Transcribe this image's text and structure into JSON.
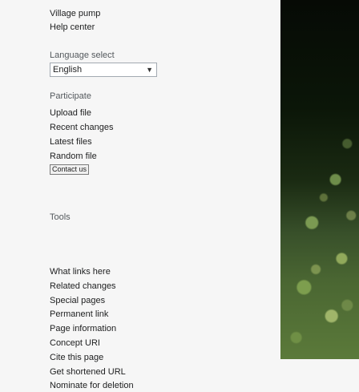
{
  "nav": {
    "village_pump": "Village pump",
    "help_center": "Help center"
  },
  "language": {
    "heading": "Language select",
    "selected": "English"
  },
  "participate": {
    "heading": "Participate",
    "items": [
      "Upload file",
      "Recent changes",
      "Latest files",
      "Random file"
    ],
    "contact_button": "Contact us"
  },
  "tools": {
    "heading": "Tools",
    "items": [
      "What links here",
      "Related changes",
      "Special pages",
      "Permanent link",
      "Page information",
      "Concept URI",
      "Cite this page",
      "Get shortened URL",
      "Nominate for deletion"
    ]
  }
}
